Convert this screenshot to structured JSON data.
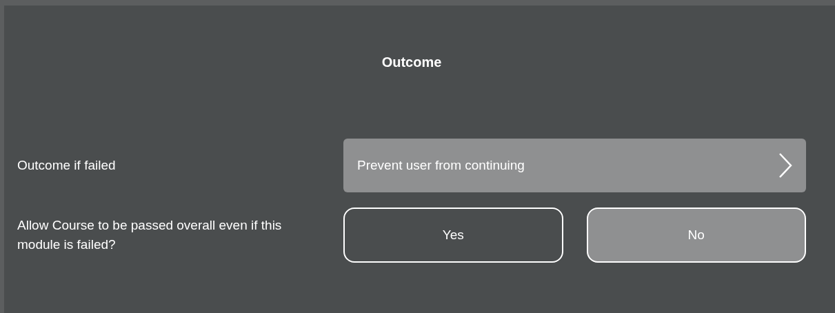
{
  "dialog": {
    "title": "Outcome",
    "fields": [
      {
        "kind": "select",
        "label": "Outcome if failed",
        "value": "Prevent user from continuing"
      },
      {
        "kind": "choice",
        "label": "Allow Course to be passed overall even if this module is failed?",
        "options": [
          {
            "label": "Yes",
            "selected": false
          },
          {
            "label": "No",
            "selected": true
          }
        ]
      }
    ]
  }
}
